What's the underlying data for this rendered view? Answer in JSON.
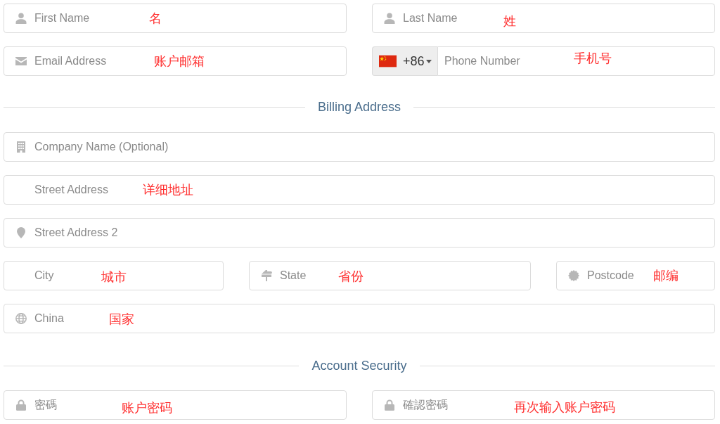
{
  "sections": [
    {
      "rows": [
        [
          {
            "kind": "name",
            "placeholder": "First Name",
            "annotation": "名"
          },
          {
            "kind": "name",
            "placeholder": "Last Name",
            "annotation": "姓"
          }
        ],
        [
          {
            "kind": "email",
            "placeholder": "Email Address",
            "annotation": "账户邮箱"
          },
          {
            "kind": "phone",
            "dial_code": "+86",
            "placeholder": "Phone Number",
            "annotation": "手机号"
          }
        ]
      ]
    },
    {
      "heading": "Billing Address",
      "rows": [
        [
          {
            "kind": "company",
            "placeholder": "Company Name (Optional)"
          }
        ],
        [
          {
            "kind": "street",
            "placeholder": "Street Address",
            "annotation": "详细地址"
          }
        ],
        [
          {
            "kind": "location",
            "placeholder": "Street Address 2"
          }
        ],
        [
          {
            "kind": "city",
            "placeholder": "City",
            "annotation": "城市"
          },
          {
            "kind": "state",
            "placeholder": "State",
            "annotation": "省份"
          },
          {
            "kind": "postcode",
            "placeholder": "Postcode",
            "annotation": "邮编"
          }
        ],
        [
          {
            "kind": "country",
            "value": "China",
            "annotation": "国家"
          }
        ]
      ]
    },
    {
      "heading": "Account Security",
      "rows": [
        [
          {
            "kind": "password",
            "placeholder": "密碼",
            "annotation": "账户密码"
          },
          {
            "kind": "password",
            "placeholder": "確認密碼",
            "annotation": "再次输入账户密码"
          }
        ]
      ]
    }
  ]
}
